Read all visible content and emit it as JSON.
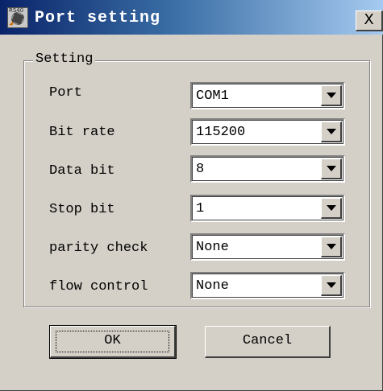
{
  "window": {
    "title": "Port setting",
    "app_icon": "app-gear-icon",
    "close_label": "X"
  },
  "group": {
    "label": "Setting"
  },
  "fields": {
    "port": {
      "label": "Port",
      "value": "COM1"
    },
    "bit_rate": {
      "label": "Bit rate",
      "value": "115200"
    },
    "data_bit": {
      "label": "Data bit",
      "value": "8"
    },
    "stop_bit": {
      "label": "Stop bit",
      "value": "1"
    },
    "parity": {
      "label": "parity check",
      "value": "None"
    },
    "flow": {
      "label": "flow control",
      "value": "None"
    }
  },
  "buttons": {
    "ok": "OK",
    "cancel": "Cancel"
  },
  "colors": {
    "face": "#d4d0c8",
    "title_start": "#0a246a",
    "title_end": "#a6caf0"
  }
}
